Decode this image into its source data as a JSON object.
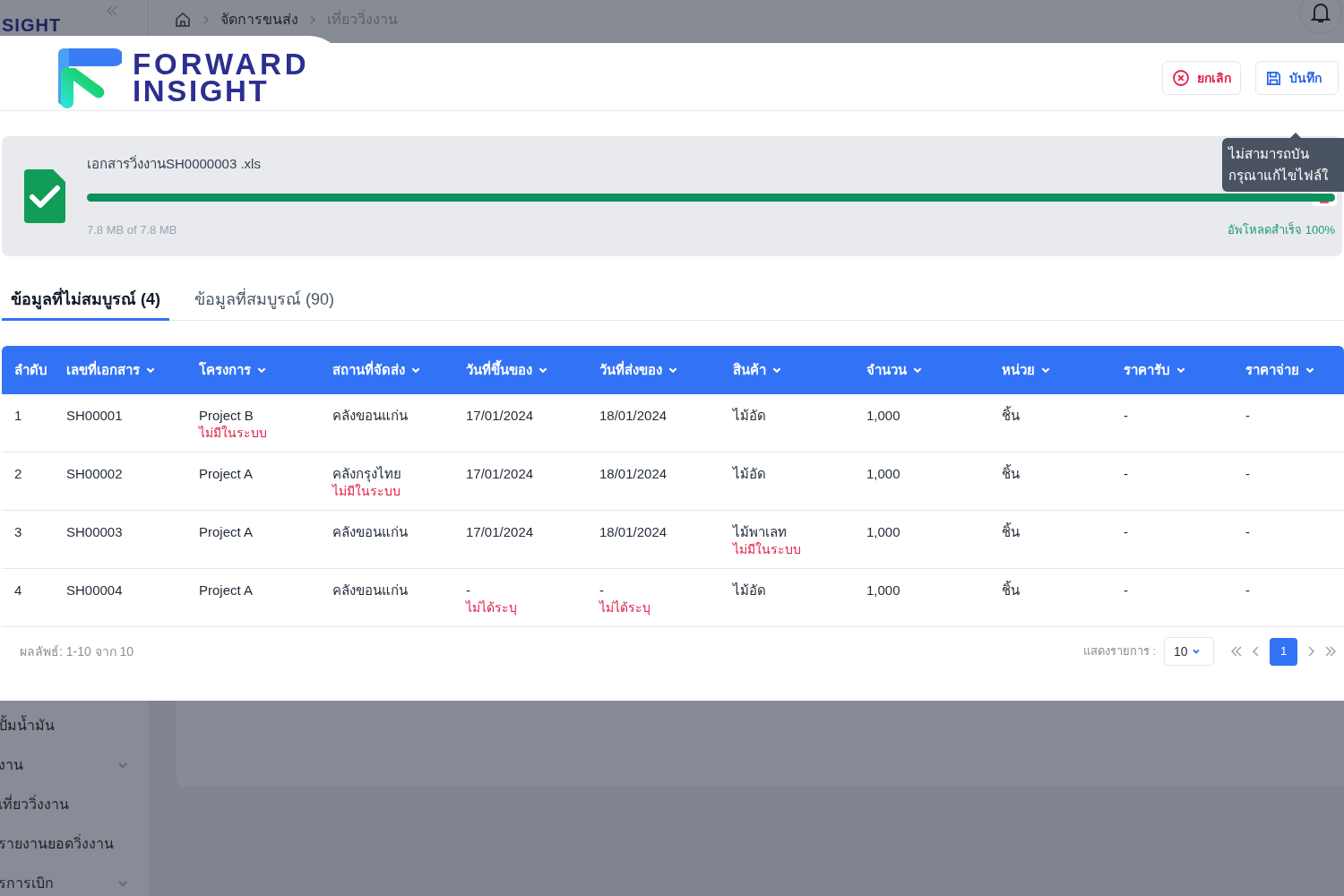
{
  "topbar": {
    "logo_text": "SIGHT",
    "breadcrumb": [
      {
        "label": "จัดการขนส่ง",
        "current": false
      },
      {
        "label": "เที่ยววิ่งงาน",
        "current": true
      }
    ]
  },
  "sidebar": {
    "items": [
      {
        "label": "ปั้มน้ำมัน",
        "expandable": false
      },
      {
        "label": "งาน",
        "expandable": true
      },
      {
        "label": "เที่ยววิ่งงาน",
        "expandable": false
      },
      {
        "label": "รายงานยอดวิ่งงาน",
        "expandable": false
      },
      {
        "label": "รการเบิก",
        "expandable": true
      }
    ]
  },
  "modal": {
    "logo": {
      "line1": "FORWARD",
      "line2": "INSIGHT"
    },
    "buttons": [
      {
        "kind": "cancel",
        "label": "ยกเลิก"
      },
      {
        "kind": "save",
        "label": "บันทึก"
      }
    ],
    "tooltip": {
      "lines": [
        "ไม่สามารถบัน",
        "กรุณาแก้ไขไฟล์ใ"
      ]
    },
    "upload": {
      "file_name": "เอกสารวิ่งงานSH0000003 .xls",
      "level": 1,
      "size": "7.8 MB of 7.8 MB",
      "status": "อัพโหลดสำเร็จ 100%"
    },
    "tabs": [
      {
        "label": "ข้อมูลที่ไม่สมบูรณ์ (4)",
        "selected": true
      },
      {
        "label": "ข้อมูลที่สมบูรณ์ (90)",
        "selected": false
      }
    ],
    "table": {
      "columns": [
        {
          "label": "ลำดับ",
          "sortable": false
        },
        {
          "label": "เลขที่เอกสาร",
          "sortable": true
        },
        {
          "label": "โครงการ",
          "sortable": true
        },
        {
          "label": "สถานที่จัดส่ง",
          "sortable": true
        },
        {
          "label": "วันที่ขึ้นของ",
          "sortable": true
        },
        {
          "label": "วันที่ส่งของ",
          "sortable": true
        },
        {
          "label": "สินค้า",
          "sortable": true
        },
        {
          "label": "จำนวน",
          "sortable": true
        },
        {
          "label": "หน่วย",
          "sortable": true
        },
        {
          "label": "ราคารับ",
          "sortable": true
        },
        {
          "label": "ราคาจ่าย",
          "sortable": true
        }
      ],
      "rows": [
        [
          {
            "text": "1"
          },
          {
            "text": "SH00001"
          },
          {
            "text": "Project B",
            "error": "ไม่มีในระบบ"
          },
          {
            "text": "คลังขอนแก่น"
          },
          {
            "text": "17/01/2024"
          },
          {
            "text": "18/01/2024"
          },
          {
            "text": "ไม้อัด"
          },
          {
            "text": "1,000"
          },
          {
            "text": "ชิ้น"
          },
          {
            "text": "-"
          },
          {
            "text": "-"
          }
        ],
        [
          {
            "text": "2"
          },
          {
            "text": "SH00002"
          },
          {
            "text": "Project A"
          },
          {
            "text": "คลังกรุงไทย",
            "error": "ไม่มีในระบบ"
          },
          {
            "text": "17/01/2024"
          },
          {
            "text": "18/01/2024"
          },
          {
            "text": "ไม้อัด"
          },
          {
            "text": "1,000"
          },
          {
            "text": "ชิ้น"
          },
          {
            "text": "-"
          },
          {
            "text": "-"
          }
        ],
        [
          {
            "text": "3"
          },
          {
            "text": "SH00003"
          },
          {
            "text": "Project A"
          },
          {
            "text": "คลังขอนแก่น"
          },
          {
            "text": "17/01/2024"
          },
          {
            "text": "18/01/2024"
          },
          {
            "text": "ไม้พาเลท",
            "error": "ไม่มีในระบบ"
          },
          {
            "text": "1,000"
          },
          {
            "text": "ชิ้น"
          },
          {
            "text": "-"
          },
          {
            "text": "-"
          }
        ],
        [
          {
            "text": "4"
          },
          {
            "text": "SH00004"
          },
          {
            "text": "Project A"
          },
          {
            "text": "คลังขอนแก่น"
          },
          {
            "text": "-",
            "error": "ไม่ได้ระบุ"
          },
          {
            "text": "-",
            "error": "ไม่ได้ระบุ"
          },
          {
            "text": "ไม้อัด"
          },
          {
            "text": "1,000"
          },
          {
            "text": "ชิ้น"
          },
          {
            "text": "-"
          },
          {
            "text": "-"
          }
        ]
      ]
    },
    "footer": {
      "summary": "ผลลัพธ์: 1-10 จาก 10",
      "page_size_label": "แสดงรายการ :",
      "page_size": "10",
      "pages": [
        {
          "label": "1",
          "selected": true
        }
      ]
    }
  }
}
